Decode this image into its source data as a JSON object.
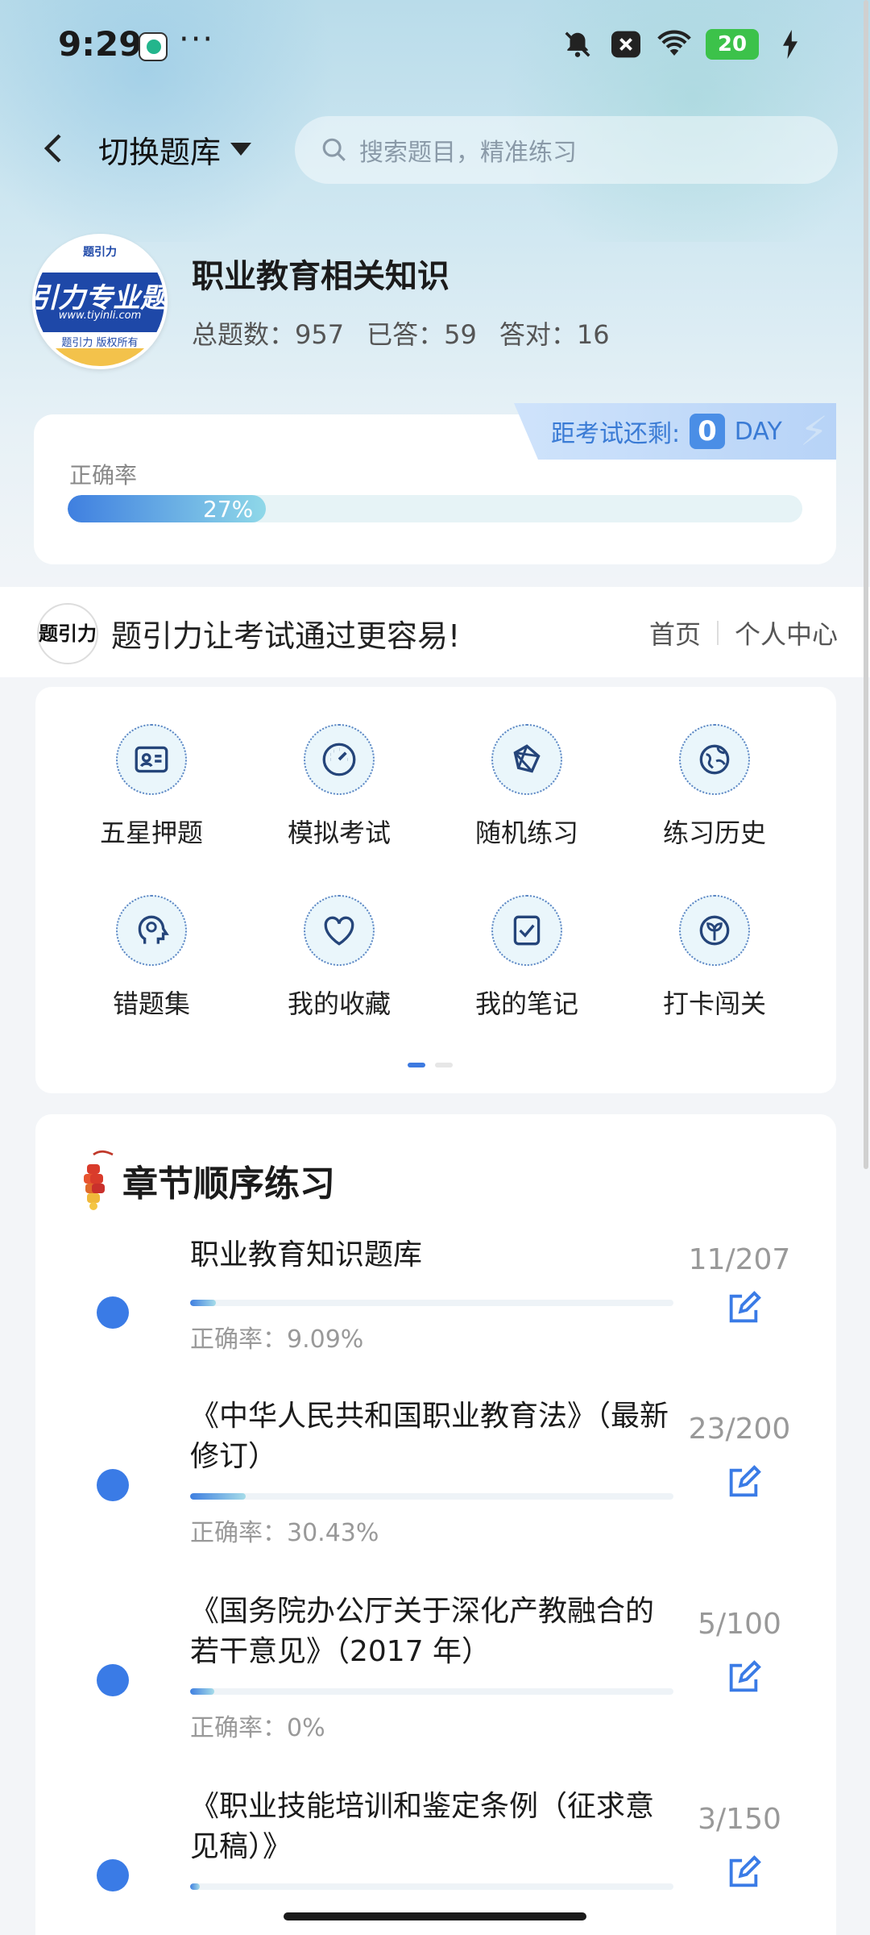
{
  "status": {
    "time": "9:29",
    "more": "···",
    "battery": "20"
  },
  "nav": {
    "switch_label": "切换题库",
    "search_placeholder": "搜索题目，精准练习"
  },
  "profile": {
    "name": "职业教育相关知识",
    "logo_top": "题引力",
    "logo_text": "引力专业题",
    "logo_url": "www.tiyinli.com",
    "logo_foot": "题引力 版权所有",
    "total_label": "总题数：",
    "total": "957",
    "answered_label": "已答：",
    "answered": "59",
    "correct_label": "答对：",
    "correct": "16"
  },
  "exam": {
    "label": "距考试还剩:",
    "days": "0",
    "unit": "DAY"
  },
  "accuracy": {
    "label": "正确率",
    "value": "27%",
    "percent": 27
  },
  "slogan": {
    "logo": "题引力",
    "text": "题引力让考试通过更容易!",
    "home": "首页",
    "center": "个人中心"
  },
  "grid": [
    {
      "label": "五星押题",
      "icon": "id-card-icon"
    },
    {
      "label": "模拟考试",
      "icon": "gauge-icon"
    },
    {
      "label": "随机练习",
      "icon": "shuffle-icon"
    },
    {
      "label": "练习历史",
      "icon": "globe-icon"
    },
    {
      "label": "错题集",
      "icon": "head-icon"
    },
    {
      "label": "我的收藏",
      "icon": "heart-icon"
    },
    {
      "label": "我的笔记",
      "icon": "note-check-icon"
    },
    {
      "label": "打卡闯关",
      "icon": "sprout-icon"
    }
  ],
  "chapters": {
    "title": "章节顺序练习",
    "accuracy_label": "正确率：",
    "items": [
      {
        "title": "职业教育知识题库",
        "accuracy": "9.09%",
        "progress": "11/207",
        "ratio": 0.053
      },
      {
        "title": "《中华人民共和国职业教育法》（最新修订）",
        "accuracy": "30.43%",
        "progress": "23/200",
        "ratio": 0.115
      },
      {
        "title": "《国务院办公厅关于深化产教融合的若干意见》（2017 年）",
        "accuracy": "0%",
        "progress": "5/100",
        "ratio": 0.05
      },
      {
        "title": "《职业技能培训和鉴定条例（征求意见稿）》",
        "accuracy": "",
        "progress": "3/150",
        "ratio": 0.02
      }
    ]
  },
  "colors": {
    "accent": "#3a7be6",
    "battery": "#3cc24a",
    "slogan_bg": "#ffffff"
  }
}
